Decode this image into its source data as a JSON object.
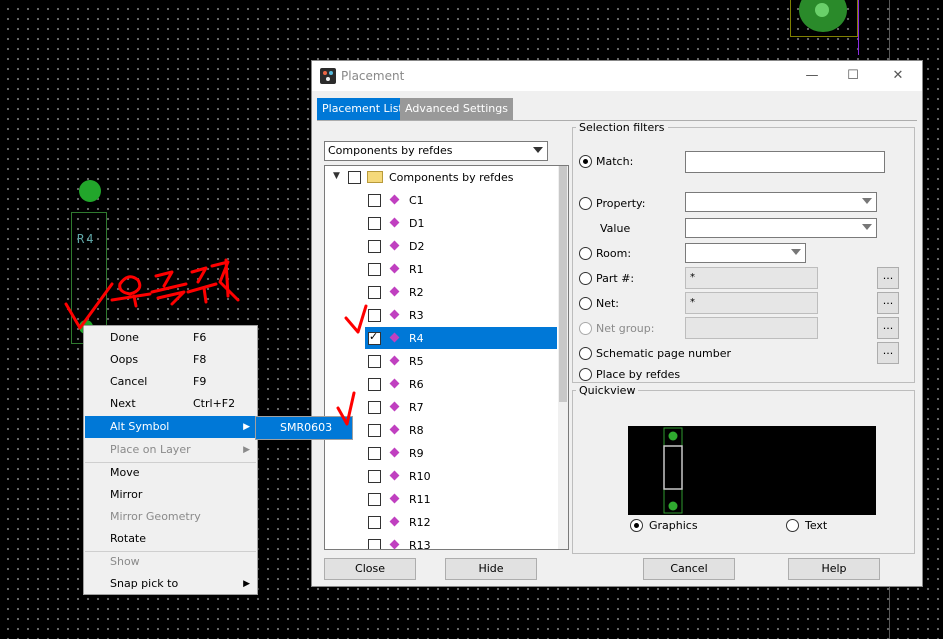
{
  "canvas": {
    "refdes_text": "R4",
    "annotation_text": "우클릭"
  },
  "context_menu": {
    "items": [
      {
        "label": "Done",
        "shortcut": "F6"
      },
      {
        "label": "Oops",
        "shortcut": "F8"
      },
      {
        "label": "Cancel",
        "shortcut": "F9"
      },
      {
        "label": "Next",
        "shortcut": "Ctrl+F2"
      },
      {
        "label": "Alt Symbol",
        "shortcut": ""
      },
      {
        "label": "Place on Layer",
        "shortcut": ""
      },
      {
        "label": "Move",
        "shortcut": ""
      },
      {
        "label": "Mirror",
        "shortcut": ""
      },
      {
        "label": "Mirror Geometry",
        "shortcut": ""
      },
      {
        "label": "Rotate",
        "shortcut": ""
      },
      {
        "label": "Show",
        "shortcut": ""
      },
      {
        "label": "Snap pick to",
        "shortcut": ""
      }
    ],
    "submenu_item": "SMR0603"
  },
  "dialog": {
    "title": "Placement",
    "tabs": [
      "Placement List",
      "Advanced Settings"
    ],
    "list_filter": "Components by refdes",
    "tree_root": "Components by refdes",
    "components": [
      {
        "name": "C1",
        "checked": false
      },
      {
        "name": "D1",
        "checked": false
      },
      {
        "name": "D2",
        "checked": false
      },
      {
        "name": "R1",
        "checked": false
      },
      {
        "name": "R2",
        "checked": false
      },
      {
        "name": "R3",
        "checked": false
      },
      {
        "name": "R4",
        "checked": true
      },
      {
        "name": "R5",
        "checked": false
      },
      {
        "name": "R6",
        "checked": false
      },
      {
        "name": "R7",
        "checked": false
      },
      {
        "name": "R8",
        "checked": false
      },
      {
        "name": "R9",
        "checked": false
      },
      {
        "name": "R10",
        "checked": false
      },
      {
        "name": "R11",
        "checked": false
      },
      {
        "name": "R12",
        "checked": false
      },
      {
        "name": "R13",
        "checked": false
      }
    ],
    "selected_component": "R4",
    "selection_filters": {
      "title": "Selection filters",
      "match_label": "Match:",
      "match_value": "",
      "property_label": "Property:",
      "value_label": "Value",
      "room_label": "Room:",
      "part_label": "Part #:",
      "part_value": "*",
      "net_label": "Net:",
      "net_value": "*",
      "net_group_label": "Net group:",
      "schematic_label": "Schematic page number",
      "place_by_refdes_label": "Place by refdes",
      "ellipsis": "..."
    },
    "quickview": {
      "title": "Quickview",
      "graphics_label": "Graphics",
      "text_label": "Text"
    },
    "buttons": {
      "close": "Close",
      "hide": "Hide",
      "cancel": "Cancel",
      "help": "Help"
    },
    "window_controls": {
      "minimize": "—",
      "maximize": "☐",
      "close": "✕"
    }
  },
  "colors": {
    "accent": "#0078d7",
    "pad_green": "#22a62b",
    "annotation_red": "#ff0000"
  }
}
